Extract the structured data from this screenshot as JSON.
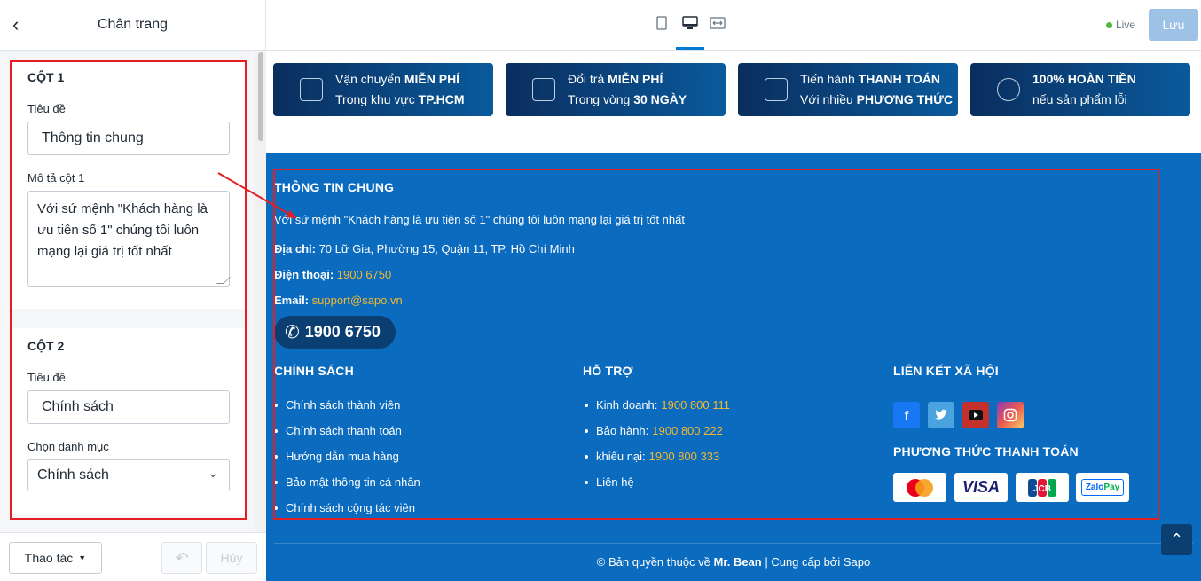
{
  "sidebar": {
    "title": "Chân trang",
    "col1": {
      "heading": "CỘT 1",
      "title_label": "Tiêu đề",
      "title_value": "Thông tin chung",
      "desc_label": "Mô tả cột 1",
      "desc_value": "Với sứ mệnh \"Khách hàng là ưu tiên số 1\" chúng tôi luôn mạng lại giá trị tốt nhất"
    },
    "col2": {
      "heading": "CỘT 2",
      "title_label": "Tiêu đề",
      "title_value": "Chính sách",
      "menu_label": "Chọn danh mục",
      "menu_value": "Chính sách"
    },
    "footer": {
      "actions_label": "Thao tác",
      "cancel_label": "Hủy"
    }
  },
  "topbar": {
    "live_label": "Live",
    "save_label": "Lưu"
  },
  "features": [
    {
      "line1_a": "Vận chuyển ",
      "line1_b": "MIỄN PHÍ",
      "line2_a": "Trong khu vực ",
      "line2_b": "TP.HCM"
    },
    {
      "line1_a": "Đổi trả ",
      "line1_b": "MIỄN PHÍ",
      "line2_a": "Trong vòng ",
      "line2_b": "30 NGÀY"
    },
    {
      "line1_a": "Tiến hành ",
      "line1_b": "THANH TOÁN",
      "line2_a": "Với nhiều ",
      "line2_b": "PHƯƠNG THỨC"
    },
    {
      "line1_a": "",
      "line1_b": "100% HOÀN TIỀN",
      "line2_a": "nếu sản phẩm lỗi",
      "line2_b": ""
    }
  ],
  "footer": {
    "info_heading": "THÔNG TIN CHUNG",
    "info_desc": "Với sứ mệnh \"Khách hàng là ưu tiên số 1\" chúng tôi luôn mạng lại giá trị tốt nhất",
    "address_label": "Địa chỉ:",
    "address_value": " 70 Lữ Gia, Phường 15, Quận 11, TP. Hồ Chí Minh",
    "phone_label": "Điện thoại:",
    "phone_value": "1900 6750",
    "email_label": "Email:",
    "email_value": "support@sapo.vn",
    "hotline": "1900 6750",
    "policy_heading": "CHÍNH SÁCH",
    "policy_items": [
      "Chính sách thành viên",
      "Chính sách thanh toán",
      "Hướng dẫn mua hàng",
      "Bảo mật thông tin cá nhân",
      "Chính sách cộng tác viên"
    ],
    "support_heading": "HỖ TRỢ",
    "support_items": [
      {
        "label": "Kinh doanh:",
        "value": "1900 800 111"
      },
      {
        "label": "Bảo hành:",
        "value": "1900 800 222"
      },
      {
        "label": "khiếu nại:",
        "value": "1900 800 333"
      },
      {
        "label": "Liên hệ",
        "value": ""
      }
    ],
    "social_heading": "LIÊN KẾT XÃ HỘI",
    "payment_heading": "PHƯƠNG THỨC THANH TOÁN",
    "payments": [
      "MasterCard",
      "VISA",
      "JCB",
      "ZaloPay"
    ],
    "copyright_a": "© Bản quyền thuộc về ",
    "copyright_b": "Mr. Bean",
    "copyright_c": " | Cung cấp bởi Sapo"
  },
  "colors": {
    "accent": "#0078d4",
    "footer_bg": "#0a6bbf",
    "highlight": "#f5b82e",
    "annotation_red": "#e31e24"
  }
}
